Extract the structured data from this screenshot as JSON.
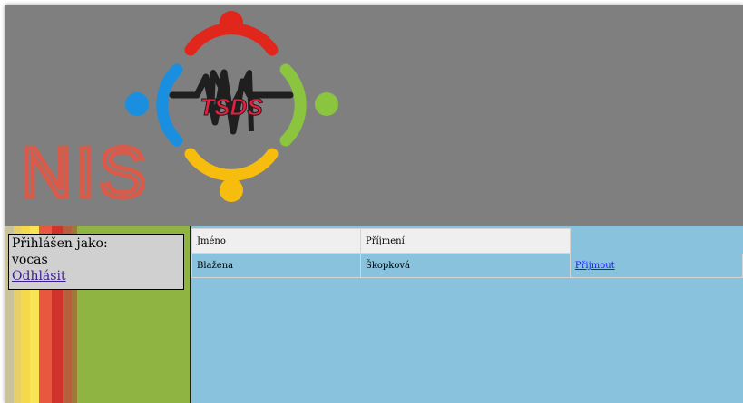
{
  "logo": {
    "nis_text": "NIS",
    "tsds_text": "TSDS",
    "colors": {
      "banner": "#7f7f7f",
      "red": "#e1261c",
      "blue": "#1a8fe0",
      "green": "#8bc43f",
      "yellow": "#f6bd0f",
      "nis": "#d95a48"
    }
  },
  "sidebar": {
    "login_label": "Přihlášen jako:",
    "username": "vocas",
    "logout_label": "Odhlásit"
  },
  "table": {
    "headers": [
      "Jméno",
      "Příjmení",
      ""
    ],
    "rows": [
      {
        "first_name": "Blažena",
        "last_name": "Škopková",
        "action": "Přijmout"
      }
    ]
  }
}
